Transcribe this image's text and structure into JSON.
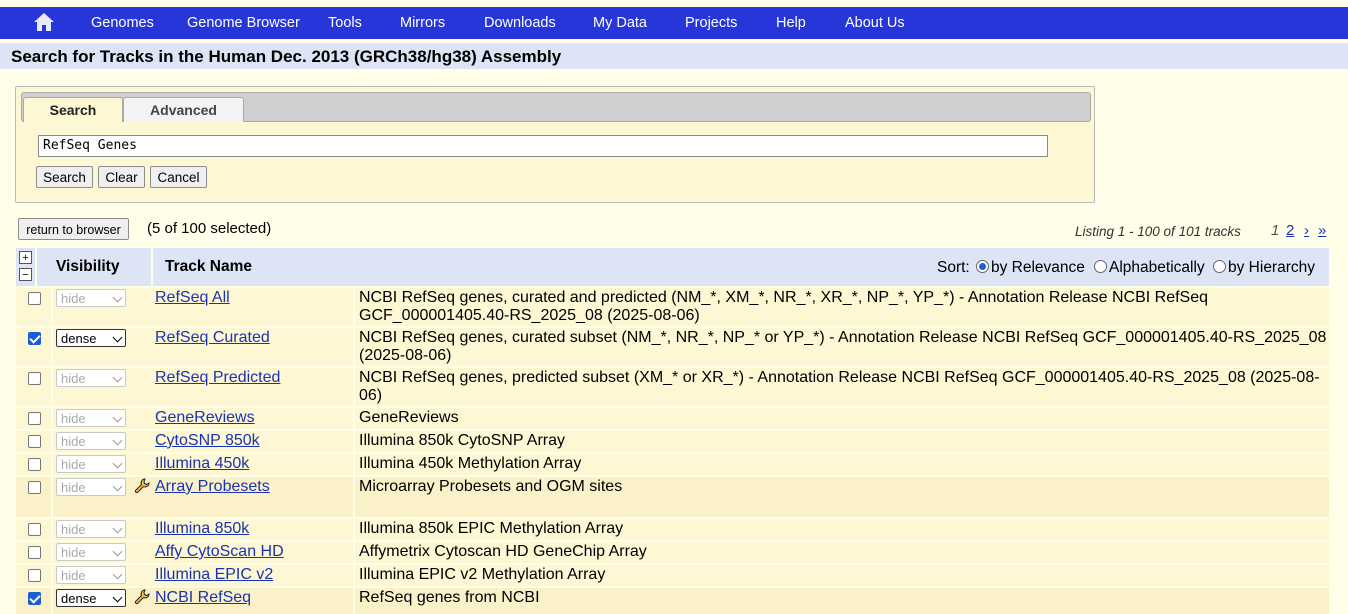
{
  "nav": {
    "items": [
      "Genomes",
      "Genome Browser",
      "Tools",
      "Mirrors",
      "Downloads",
      "My Data",
      "Projects",
      "Help",
      "About Us"
    ],
    "home_icon": "home-icon"
  },
  "page": {
    "title": "Search for Tracks in the Human Dec. 2013 (GRCh38/hg38) Assembly"
  },
  "search": {
    "tabs": [
      "Search",
      "Advanced"
    ],
    "active_tab": "Search",
    "query": "RefSeq Genes",
    "buttons": {
      "search": "Search",
      "clear": "Clear",
      "cancel": "Cancel"
    }
  },
  "results": {
    "return_button": "return to browser",
    "selected_text": "(5 of 100 selected)",
    "listing_text": "Listing 1 - 100 of 101 tracks",
    "pages": {
      "current": "1",
      "next_page": "2",
      "next": "›",
      "last": "»"
    },
    "header": {
      "plus": "+",
      "minus": "−",
      "visibility": "Visibility",
      "track_name": "Track Name",
      "sort_label": "Sort:",
      "sort_options": [
        "by Relevance",
        "Alphabetically",
        "by Hierarchy"
      ],
      "sort_selected": "by Relevance"
    },
    "rows": [
      {
        "checked": false,
        "visibility": "hide",
        "has_config": false,
        "name": "RefSeq All",
        "description": "NCBI RefSeq genes, curated and predicted (NM_*, XM_*, NR_*, XR_*, NP_*, YP_*) - Annotation Release NCBI RefSeq GCF_000001405.40-RS_2025_08 (2025-08-06)"
      },
      {
        "checked": true,
        "visibility": "dense",
        "has_config": false,
        "name": "RefSeq Curated",
        "description": "NCBI RefSeq genes, curated subset (NM_*, NR_*, NP_* or YP_*) - Annotation Release NCBI RefSeq GCF_000001405.40-RS_2025_08 (2025-08-06)"
      },
      {
        "checked": false,
        "visibility": "hide",
        "has_config": false,
        "name": "RefSeq Predicted",
        "description": "NCBI RefSeq genes, predicted subset (XM_* or XR_*) - Annotation Release NCBI RefSeq GCF_000001405.40-RS_2025_08 (2025-08-06)"
      },
      {
        "checked": false,
        "visibility": "hide",
        "has_config": false,
        "name": "GeneReviews",
        "description": "GeneReviews"
      },
      {
        "checked": false,
        "visibility": "hide",
        "has_config": false,
        "name": "CytoSNP 850k",
        "description": "Illumina 850k CytoSNP Array"
      },
      {
        "checked": false,
        "visibility": "hide",
        "has_config": false,
        "name": "Illumina 450k",
        "description": "Illumina 450k Methylation Array"
      },
      {
        "checked": false,
        "visibility": "hide",
        "has_config": true,
        "name": "Array Probesets",
        "description": "Microarray Probesets and OGM sites"
      },
      {
        "checked": false,
        "visibility": "hide",
        "has_config": false,
        "name": "Illumina 850k",
        "description": "Illumina 850k EPIC Methylation Array"
      },
      {
        "checked": false,
        "visibility": "hide",
        "has_config": false,
        "name": "Affy CytoScan HD",
        "description": "Affymetrix Cytoscan HD GeneChip Array"
      },
      {
        "checked": false,
        "visibility": "hide",
        "has_config": false,
        "name": "Illumina EPIC v2",
        "description": "Illumina EPIC v2 Methylation Array"
      },
      {
        "checked": true,
        "visibility": "dense",
        "has_config": true,
        "name": "NCBI RefSeq",
        "description": "RefSeq genes from NCBI"
      }
    ]
  }
}
